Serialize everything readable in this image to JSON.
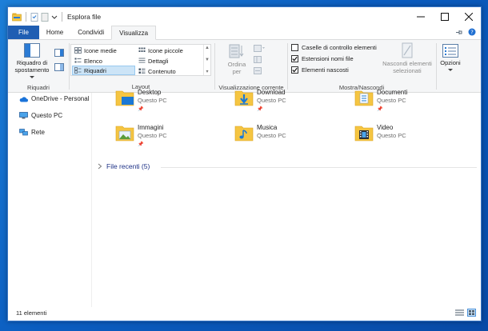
{
  "window": {
    "title": "Esplora file"
  },
  "tabs": [
    {
      "label": "File"
    },
    {
      "label": "Home"
    },
    {
      "label": "Condividi"
    },
    {
      "label": "Visualizza"
    }
  ],
  "ribbon": {
    "panes": {
      "nav_pane_label_1": "Riquadro di",
      "nav_pane_label_2": "spostamento",
      "group_label": "Riquadri"
    },
    "layout": {
      "items": [
        "Icone medie",
        "Icone piccole",
        "Elenco",
        "Dettagli",
        "Riquadri",
        "Contenuto"
      ],
      "selected": "Riquadri",
      "group_label": "Layout"
    },
    "current_view": {
      "sort_label_1": "Ordina",
      "sort_label_2": "per",
      "group_label": "Visualizzazione corrente"
    },
    "show_hide": {
      "checkboxes": [
        {
          "label": "Caselle di controllo elementi",
          "checked": false
        },
        {
          "label": "Estensioni nomi file",
          "checked": true
        },
        {
          "label": "Elementi nascosti",
          "checked": true
        }
      ],
      "hide_selected_1": "Nascondi elementi",
      "hide_selected_2": "selezionati",
      "group_label": "Mostra/Nascondi"
    },
    "options": {
      "label": "Opzioni"
    }
  },
  "nav": {
    "items": [
      {
        "label": "OneDrive - Personal"
      },
      {
        "label": "Questo PC"
      },
      {
        "label": "Rete"
      }
    ]
  },
  "tiles": [
    {
      "name": "Desktop",
      "location": "Questo PC"
    },
    {
      "name": "Download",
      "location": "Questo PC"
    },
    {
      "name": "Documenti",
      "location": "Questo PC"
    },
    {
      "name": "Immagini",
      "location": "Questo PC"
    },
    {
      "name": "Musica",
      "location": "Questo PC"
    },
    {
      "name": "Video",
      "location": "Questo PC"
    }
  ],
  "recent": {
    "label": "File recenti (5)"
  },
  "status": {
    "count": "11 elementi"
  },
  "colors": {
    "accent": "#1f5eb3",
    "folder": "#f5c542",
    "selection": "#cce4f7"
  }
}
